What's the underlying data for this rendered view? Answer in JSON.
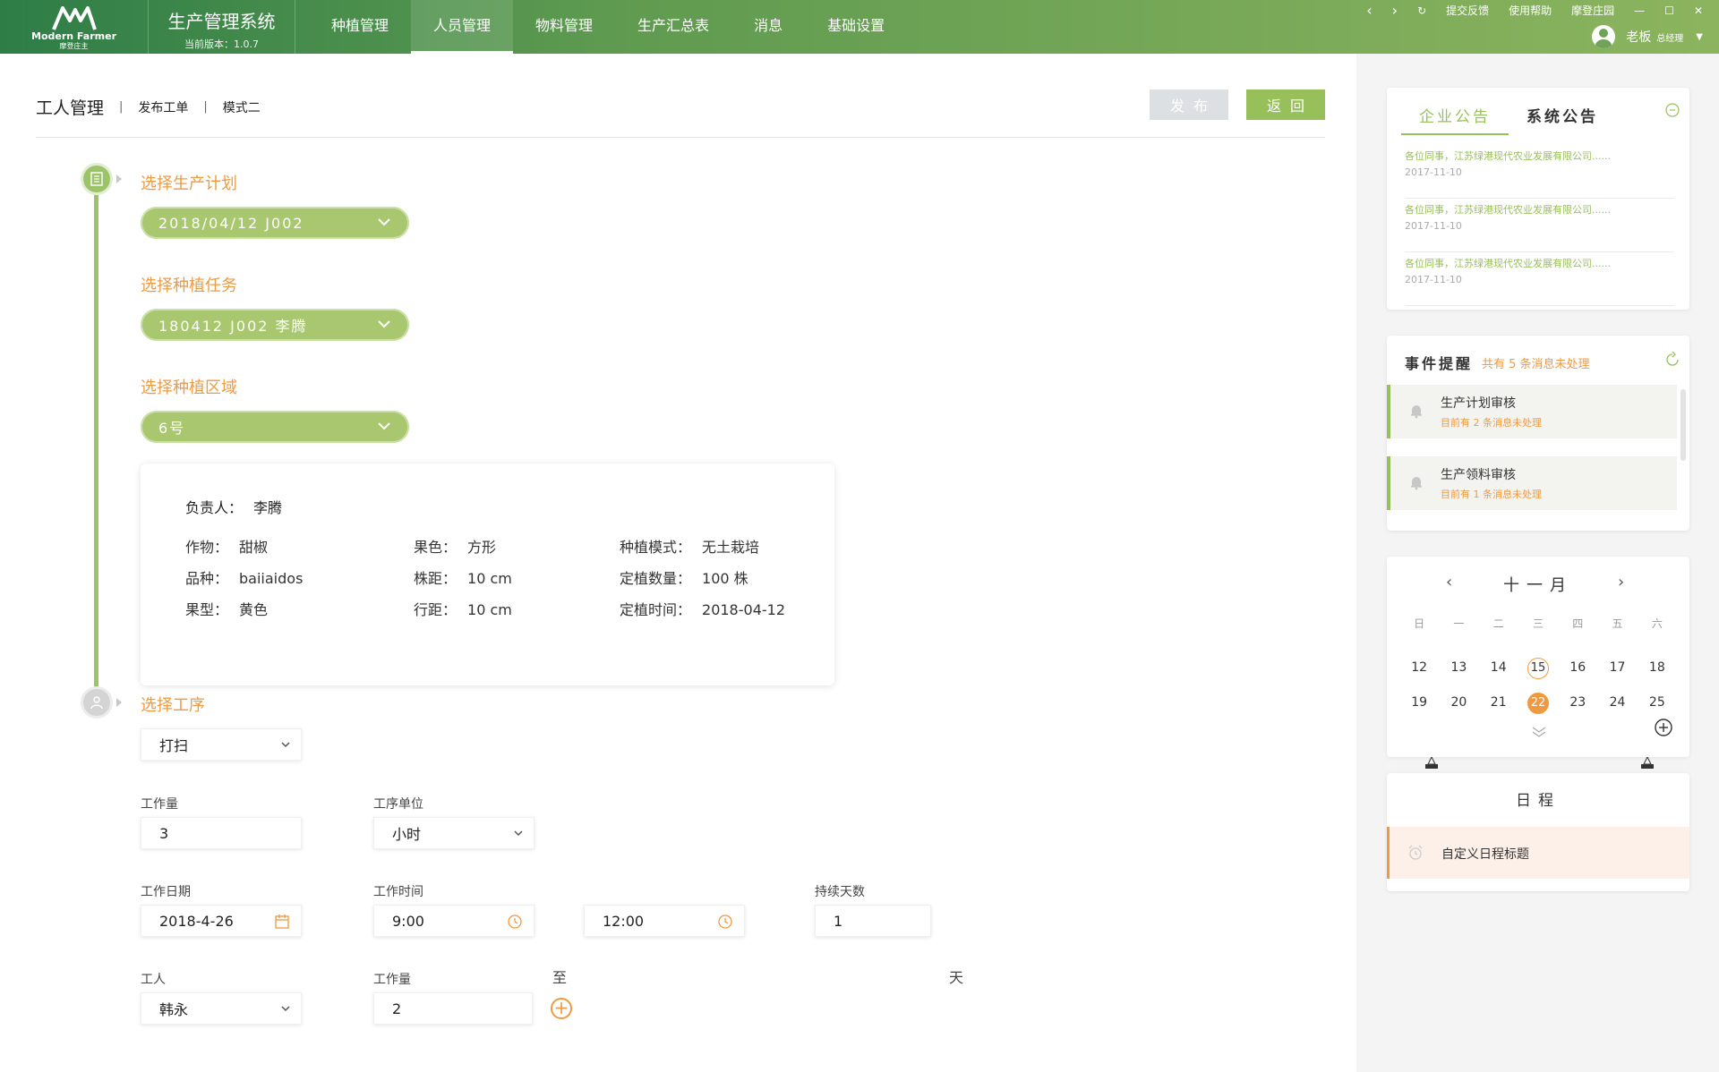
{
  "app": {
    "logo_en": "Modern Farmer",
    "logo_cn": "摩登庄主",
    "title": "生产管理系统",
    "version": "当前版本：1.0.7"
  },
  "nav": {
    "items": [
      "种植管理",
      "人员管理",
      "物料管理",
      "生产汇总表",
      "消息",
      "基础设置"
    ],
    "active": "人员管理"
  },
  "topbar": {
    "feedback": "提交反馈",
    "help": "使用帮助",
    "farm": "摩登庄园",
    "user_name": "老板",
    "user_role": "总经理"
  },
  "breadcrumb": {
    "main": "工人管理",
    "sub1": "发布工单",
    "sub2": "模式二"
  },
  "buttons": {
    "publish": "发布",
    "back": "返回"
  },
  "steps": {
    "plan_title": "选择生产计划",
    "plan_value": "2018/04/12  J002",
    "task_title": "选择种植任务",
    "task_value": "180412  J002  李腾",
    "area_title": "选择种植区域",
    "area_value": "6号",
    "process_title": "选择工序"
  },
  "info": {
    "owner_label": "负责人：",
    "owner": "李腾",
    "rows": [
      [
        {
          "k": "作物：",
          "v": "甜椒"
        },
        {
          "k": "果色：",
          "v": "方形"
        },
        {
          "k": "种植模式：",
          "v": "无土栽培"
        }
      ],
      [
        {
          "k": "品种：",
          "v": "baiiaidos"
        },
        {
          "k": "株距：",
          "v": "10 cm"
        },
        {
          "k": "定植数量：",
          "v": "100 株"
        }
      ],
      [
        {
          "k": "果型：",
          "v": "黄色"
        },
        {
          "k": "行距：",
          "v": "10 cm"
        },
        {
          "k": "定植时间：",
          "v": "2018-04-12"
        }
      ]
    ]
  },
  "form": {
    "process_value": "打扫",
    "workload_label": "工作量",
    "workload_value": "3",
    "unit_label": "工序单位",
    "unit_value": "小时",
    "date_label": "工作日期",
    "date_value": "2018-4-26",
    "time_label": "工作时间",
    "time_start": "9:00",
    "time_to": "至",
    "time_end": "12:00",
    "days_label": "持续天数",
    "days_value": "1",
    "days_unit": "天",
    "worker_label": "工人",
    "worker_value": "韩永",
    "worker_load_label": "工作量",
    "worker_load_value": "2"
  },
  "notice": {
    "tab_company": "企业公告",
    "tab_system": "系统公告",
    "items": [
      {
        "text": "各位同事，江苏绿港现代农业发展有限公司......",
        "date": "2017-11-10"
      },
      {
        "text": "各位同事，江苏绿港现代农业发展有限公司......",
        "date": "2017-11-10"
      },
      {
        "text": "各位同事，江苏绿港现代农业发展有限公司......",
        "date": "2017-11-10"
      }
    ]
  },
  "events": {
    "title": "事件提醒",
    "summary": "共有 5 条消息未处理",
    "items": [
      {
        "name": "生产计划审核",
        "count": "目前有  2  条消息未处理"
      },
      {
        "name": "生产领料审核",
        "count": "目前有  1  条消息未处理"
      }
    ]
  },
  "calendar": {
    "month": "十一月",
    "weekdays": [
      "日",
      "一",
      "二",
      "三",
      "四",
      "五",
      "六"
    ],
    "rows": [
      [
        "12",
        "13",
        "14",
        "15",
        "16",
        "17",
        "18"
      ],
      [
        "19",
        "20",
        "21",
        "22",
        "23",
        "24",
        "25"
      ]
    ],
    "today": "15",
    "selected": "22",
    "accent": "#ef9a40"
  },
  "schedule": {
    "title": "日程",
    "item": "自定义日程标题"
  },
  "colors": {
    "green": "#98c05a",
    "orange": "#ef9a40"
  }
}
